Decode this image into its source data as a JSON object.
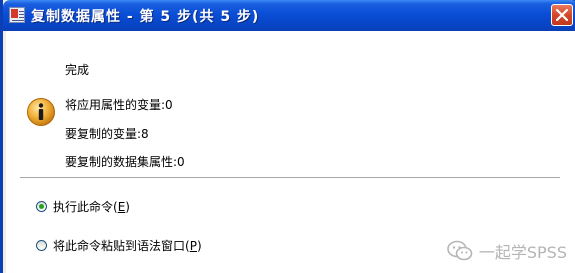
{
  "window": {
    "title": "复制数据属性 - 第 5 步(共 5 步)"
  },
  "content": {
    "heading": "完成",
    "info_lines": [
      "将应用属性的变量:0",
      "要复制的变量:8",
      "要复制的数据集属性:0"
    ]
  },
  "options": {
    "run_now": {
      "label": "执行此命令(",
      "key": "E",
      "suffix": ")",
      "selected": true
    },
    "paste_syntax": {
      "label": "将此命令粘贴到语法窗口(",
      "key": "P",
      "suffix": ")",
      "selected": false
    }
  },
  "watermark": {
    "text": "一起学SPSS"
  },
  "icons": {
    "app": "spss-app-icon",
    "close": "close-icon",
    "info": "info-icon",
    "wechat": "wechat-icon"
  },
  "colors": {
    "titlebar": "#0a4ed6",
    "close": "#d6472a",
    "info_icon": "#e8a21c",
    "radio_check": "#21a121"
  }
}
